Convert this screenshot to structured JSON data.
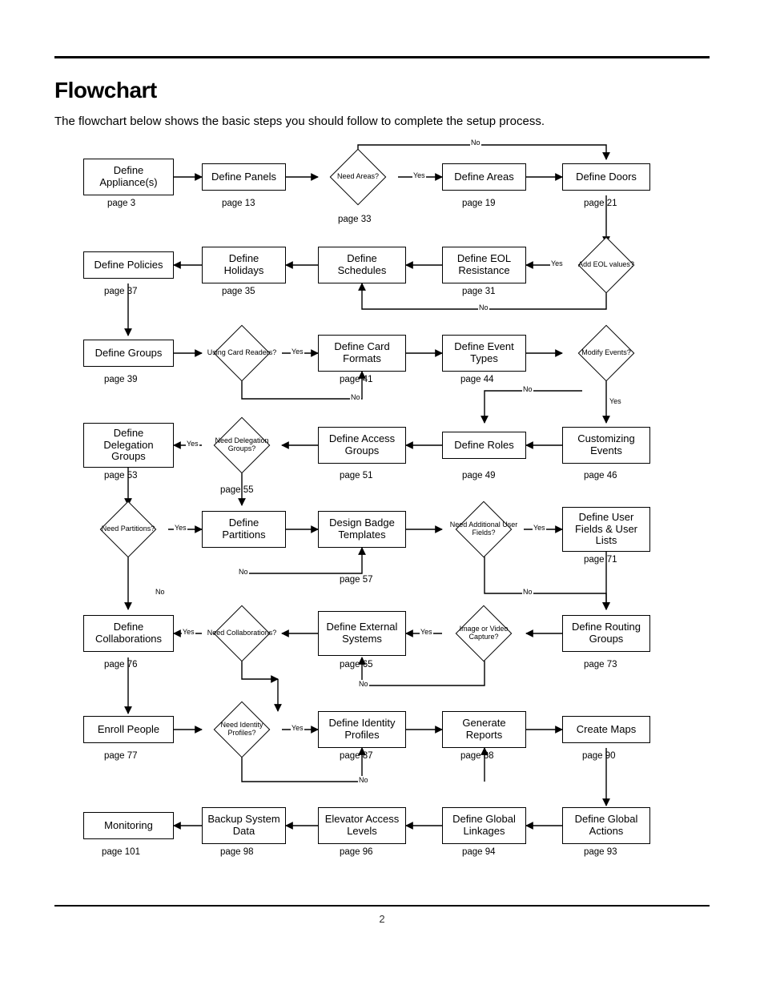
{
  "title": "Flowchart",
  "intro": "The flowchart below shows the basic steps you should follow to complete the setup process.",
  "page_number": "2",
  "yes": "Yes",
  "no": "No",
  "nodes": {
    "r1c1": "Define Appliance(s)",
    "r1c2": "Define Panels",
    "r1c3": "Need Areas?",
    "r1c4": "Define Areas",
    "r1c5": "Define Doors",
    "r2c1": "Define Policies",
    "r2c2": "Define Holidays",
    "r2c3": "Define Schedules",
    "r2c4": "Define EOL Resistance",
    "r2c5": "Add EOL values?",
    "r3c1": "Define Groups",
    "r3c2": "Using Card Readers?",
    "r3c3": "Define Card Formats",
    "r3c4": "Define Event Types",
    "r3c5": "Modify Events?",
    "r4c1": "Define Delegation Groups",
    "r4c2": "Need Delegation Groups?",
    "r4c3": "Define Access Groups",
    "r4c4": "Define Roles",
    "r4c5": "Customizing Events",
    "r5c1": "Need Partitions?",
    "r5c2": "Define Partitions",
    "r5c3": "Design Badge Templates",
    "r5c4": "Need Additional User Fields?",
    "r5c5": "Define User Fields & User Lists",
    "r6c1": "Define Collaborations",
    "r6c2": "Need Collaborations?",
    "r6c3": "Define External Systems",
    "r6c4": "Image or Video Capture?",
    "r6c5": "Define Routing Groups",
    "r7c1": "Enroll People",
    "r7c2": "Need Identity Profiles?",
    "r7c3": "Define Identity Profiles",
    "r7c4": "Generate Reports",
    "r7c5": "Create Maps",
    "r8c1": "Monitoring",
    "r8c2": "Backup System Data",
    "r8c3": "Elevator Access Levels",
    "r8c4": "Define Global Linkages",
    "r8c5": "Define Global Actions"
  },
  "pages": {
    "r1c1": "page  3",
    "r1c2": "page  13",
    "r1c3": "page  33",
    "r1c4": "page  19",
    "r1c5": "page  21",
    "r2c1": "page 37",
    "r2c2": "page  35",
    "r2c4": "page  31",
    "r3c1": "page  39",
    "r3c3": "page  41",
    "r3c4": "page 44",
    "r4c1": "page  53",
    "r4c2": "page  55",
    "r4c3": "page  51",
    "r4c4": "page  49",
    "r4c5": "page  46",
    "r5c3": "page  57",
    "r5c5": "page  71",
    "r6c1": "page  76",
    "r6c3": "page  65",
    "r6c5": "page  73",
    "r7c1": "page  77",
    "r7c3": "page  87",
    "r7c4": "page 88",
    "r7c5": "page 90",
    "r8c1": "page  101",
    "r8c2": "page  98",
    "r8c3": "page  96",
    "r8c4": "page  94",
    "r8c5": "page  93"
  }
}
